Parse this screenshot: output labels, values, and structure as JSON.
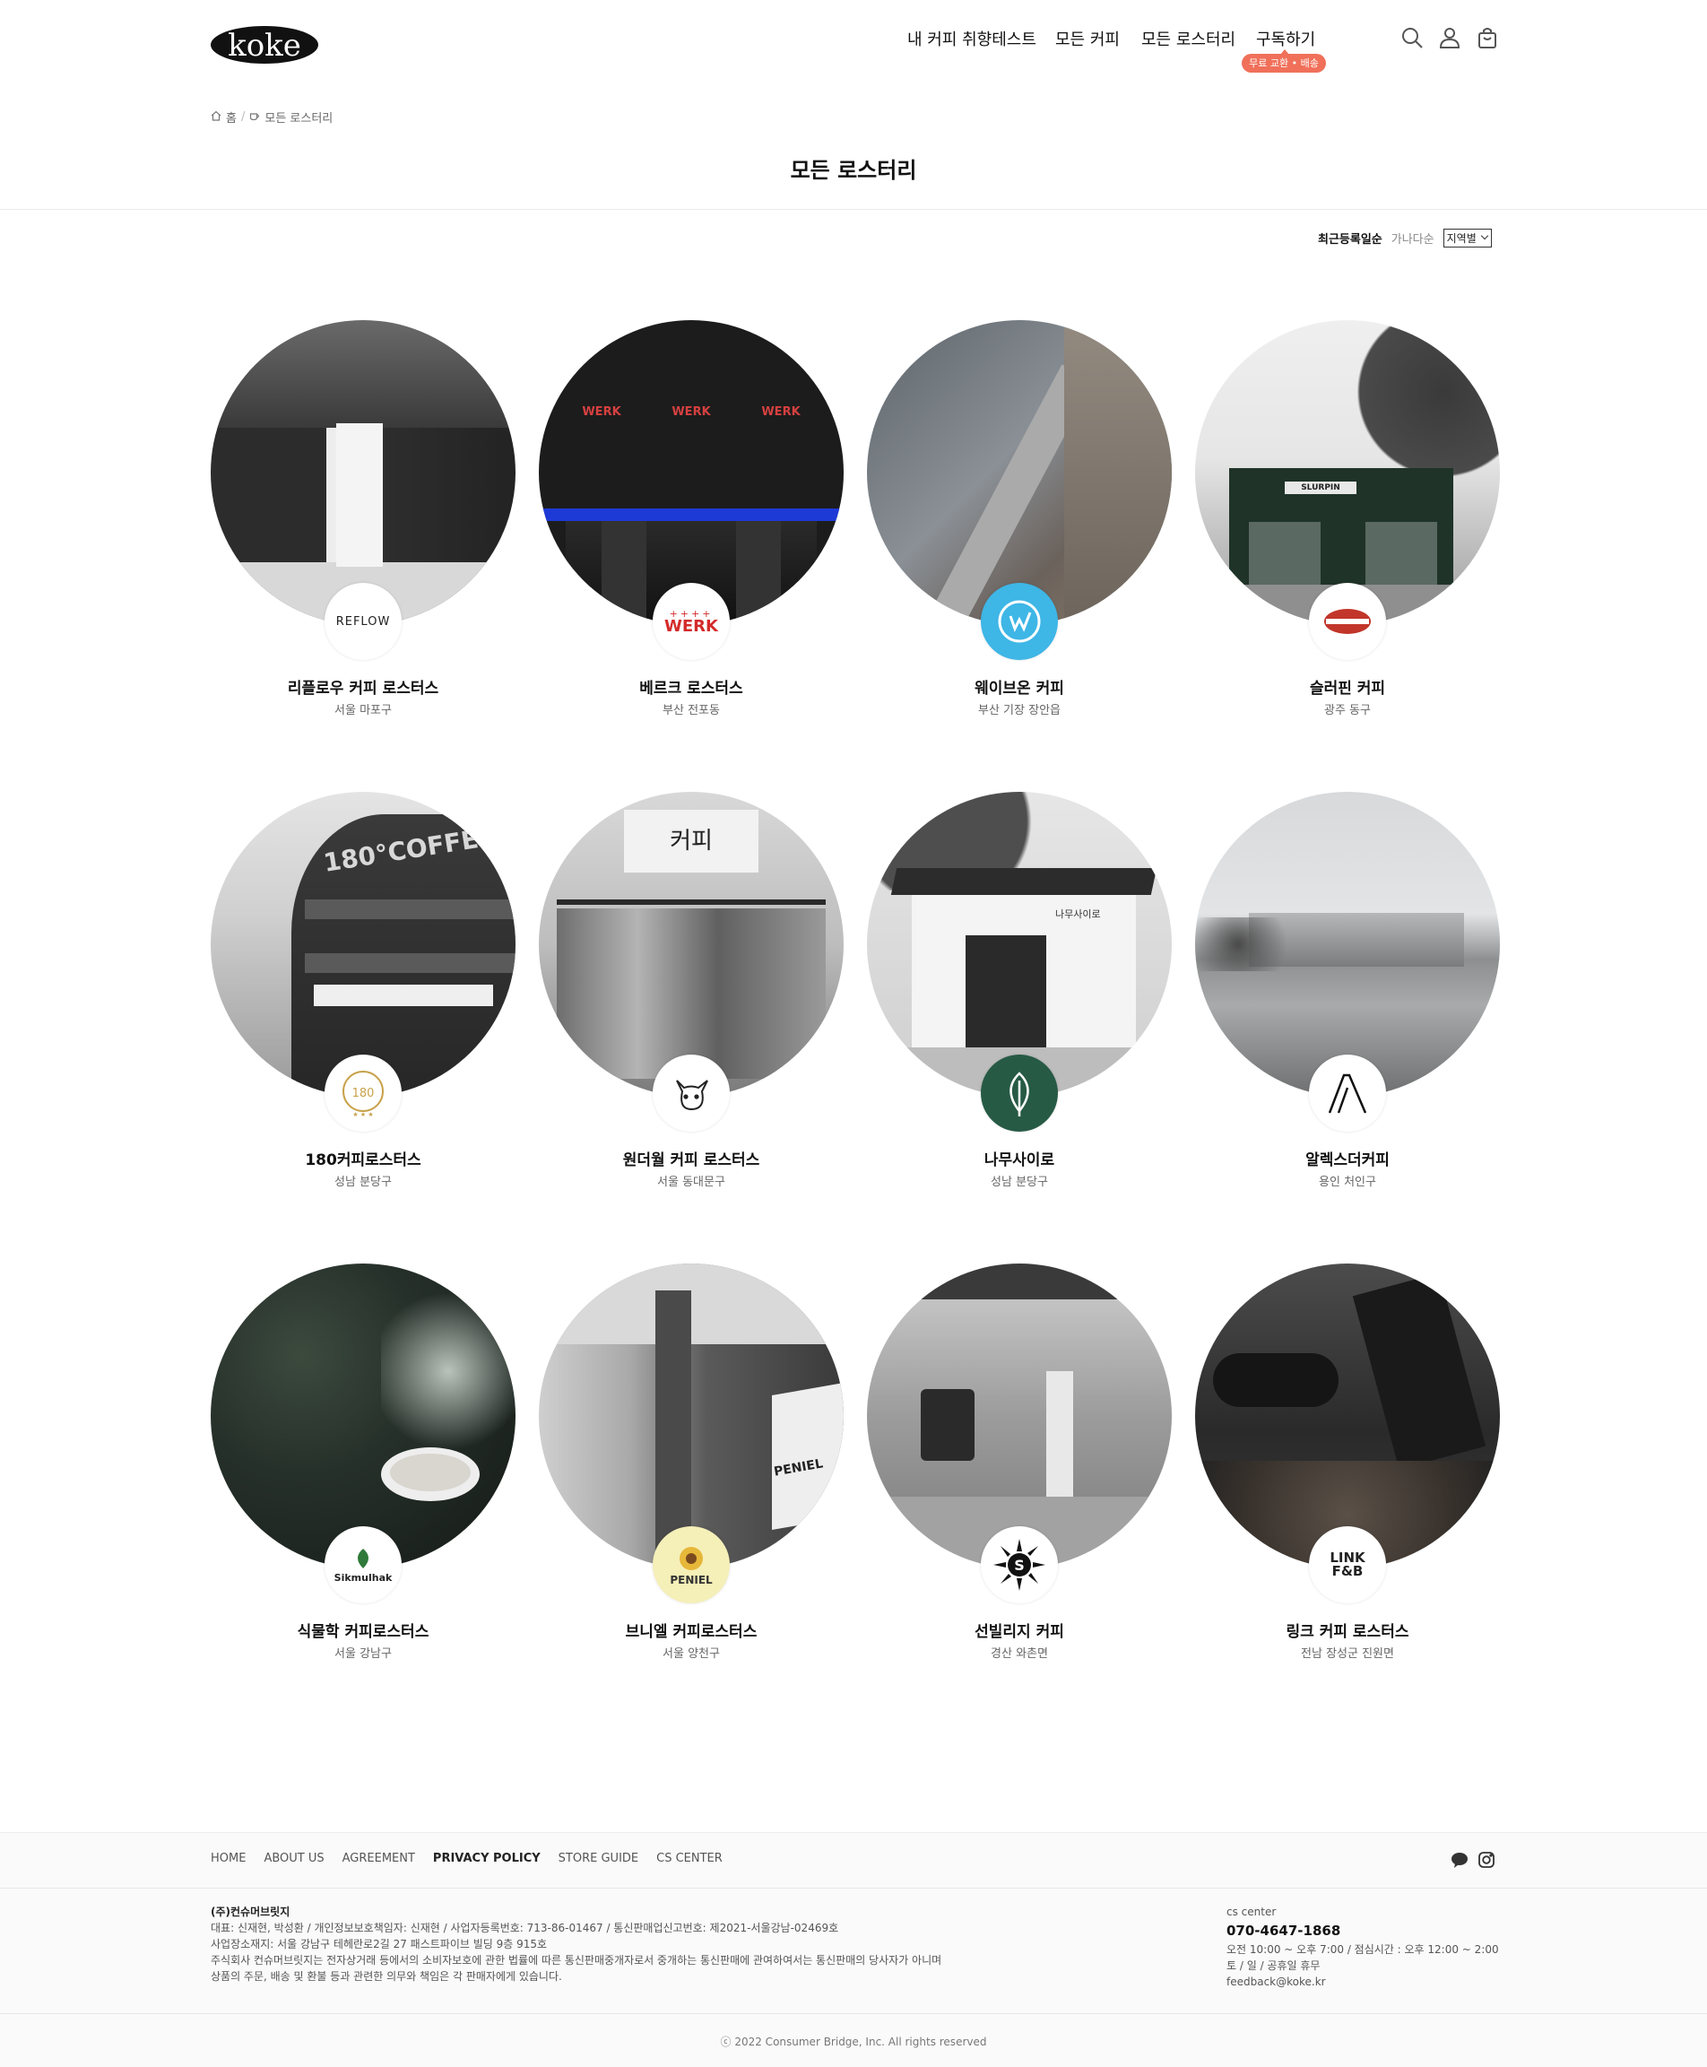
{
  "header": {
    "logo_text": "koke",
    "nav": [
      {
        "label": "내 커피 취향테스트"
      },
      {
        "label": "모든 커피"
      },
      {
        "label": "모든 로스터리"
      },
      {
        "label": "구독하기"
      }
    ],
    "subscribe_badge": "무료 교환 • 배송",
    "icons": [
      "search-icon",
      "user-icon",
      "cart-icon"
    ]
  },
  "breadcrumb": {
    "home": "홈",
    "current": "모든 로스터리"
  },
  "page_title": "모든 로스터리",
  "sort": {
    "options": [
      "최근등록일순",
      "가나다순"
    ],
    "active": "최근등록일순",
    "region_select": "지역별"
  },
  "roasteries": [
    {
      "name": "리플로우 커피 로스터스",
      "location": "서울 마포구",
      "logo_text": "REFLOW"
    },
    {
      "name": "베르크 로스터스",
      "location": "부산 전포동",
      "logo_text": "WERK",
      "photo_text": "WERK"
    },
    {
      "name": "웨이브온 커피",
      "location": "부산 기장 장안읍",
      "logo_text": ""
    },
    {
      "name": "슬러핀 커피",
      "location": "광주 동구",
      "logo_text": "",
      "photo_text": "SLURPIN"
    },
    {
      "name": "180커피로스터스",
      "location": "성남 분당구",
      "logo_text": "180",
      "photo_text": "180°COFFEE"
    },
    {
      "name": "원더월 커피 로스터스",
      "location": "서울 동대문구",
      "logo_text": "",
      "photo_text": "커피"
    },
    {
      "name": "나무사이로",
      "location": "성남 분당구",
      "logo_text": "",
      "photo_text": "나무사이로"
    },
    {
      "name": "알렉스더커피",
      "location": "용인 처인구",
      "logo_text": "A"
    },
    {
      "name": "식물학 커피로스터스",
      "location": "서울 강남구",
      "logo_text": "Sikmulhak"
    },
    {
      "name": "브니엘 커피로스터스",
      "location": "서울 양천구",
      "logo_text": "PENIEL",
      "photo_text": "PENIEL"
    },
    {
      "name": "선빌리지 커피",
      "location": "경산 와촌면",
      "logo_text": "S"
    },
    {
      "name": "링크 커피 로스터스",
      "location": "전남 장성군 진원면",
      "logo_text": "LINK F&B"
    }
  ],
  "footer": {
    "links": [
      "HOME",
      "ABOUT US",
      "AGREEMENT",
      "PRIVACY POLICY",
      "STORE GUIDE",
      "CS CENTER"
    ],
    "company_name": "(주)컨슈머브릿지",
    "company_lines": [
      "대표: 신재현, 박성환 / 개인정보보호책임자: 신재현 / 사업자등록번호: 713-86-01467 / 통신판매업신고번호: 제2021-서울강남-02469호",
      "사업장소재지: 서울 강남구 테헤란로2길 27 패스트파이브 빌딩 9층 915호",
      "주식회사 컨슈머브릿지는 전자상거래 등에서의 소비자보호에 관한 법률에 따른 통신판매중개자로서 중개하는 통신판매에 관여하여서는 통신판매의 당사자가 아니며",
      "상품의 주문, 배송 및 환불 등과 관련한 의무와 책임은 각 판매자에게 있습니다."
    ],
    "cs_label": "cs center",
    "cs_phone": "070-4647-1868",
    "cs_hours": "오전 10:00 ~ 오후 7:00 / 점심시간 : 오후 12:00 ~ 2:00",
    "cs_holiday": "토 / 일 / 공휴일 휴무",
    "cs_email": "feedback@koke.kr",
    "copyright": "ⓒ 2022 Consumer Bridge, Inc. All rights reserved"
  }
}
